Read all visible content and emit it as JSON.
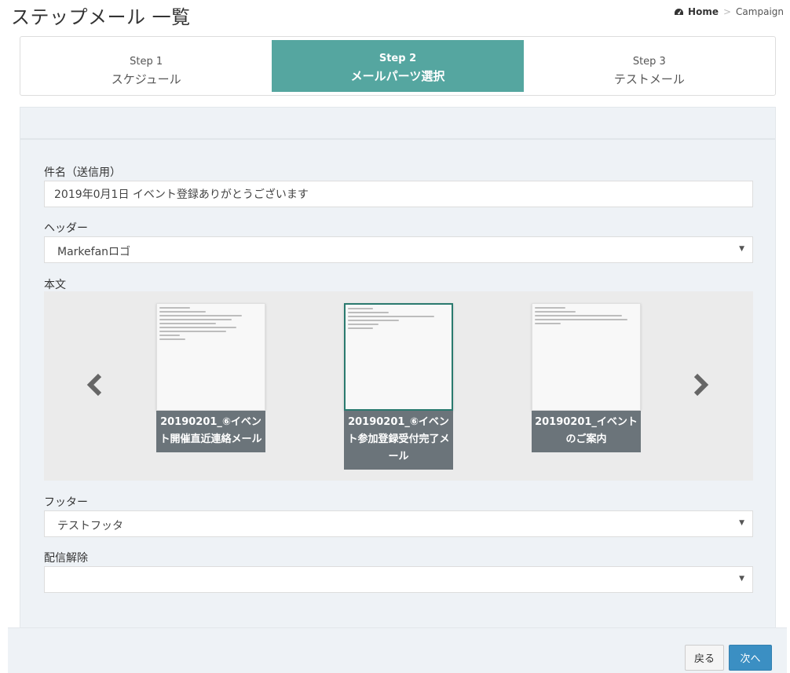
{
  "header": {
    "title": "ステップメール 一覧",
    "breadcrumb": {
      "home": "Home",
      "separator": ">",
      "current": "Campaign",
      "home_icon": "dashboard-icon"
    }
  },
  "steps": [
    {
      "num": "Step 1",
      "name": "スケジュール",
      "active": false
    },
    {
      "num": "Step 2",
      "name": "メールパーツ選択",
      "active": true
    },
    {
      "num": "Step 3",
      "name": "テストメール",
      "active": false
    }
  ],
  "form": {
    "subject_label": "件名（送信用）",
    "subject_value": "2019年0月1日 イベント登録ありがとうございます",
    "header_label": "ヘッダー",
    "header_value": "Markefanロゴ",
    "body_label": "本文",
    "footer_label": "フッター",
    "footer_value": "テストフッタ",
    "unsubscribe_label": "配信解除",
    "unsubscribe_value": ""
  },
  "carousel": {
    "prev_icon": "chevron-left-icon",
    "next_icon": "chevron-right-icon",
    "cards": [
      {
        "caption": "20190201_⑥イベント開催直近連絡メール",
        "selected": false
      },
      {
        "caption": "20190201_⑥イベント参加登録受付完了メール",
        "selected": true
      },
      {
        "caption": "20190201_イベントのご案内",
        "selected": false
      }
    ]
  },
  "actions": {
    "back_label": "戻る",
    "next_label": "次へ"
  },
  "colors": {
    "step_active": "#55a6a0",
    "next_button": "#3b8fc3",
    "caption_bg": "#6b747a",
    "selected_border": "#2a7a6f"
  }
}
